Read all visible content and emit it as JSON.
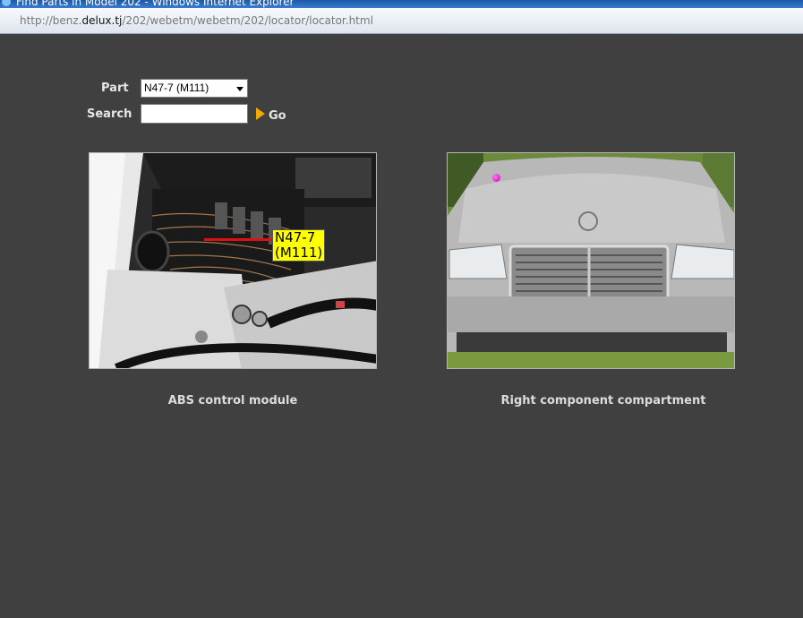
{
  "window": {
    "title": "Find Parts in Model 202 - Windows Internet Explorer"
  },
  "address": {
    "prefix": "http://benz.",
    "domain": "delux.tj",
    "suffix": "/202/webetm/webetm/202/locator/locator.html"
  },
  "form": {
    "part_label": "Part",
    "part_value": "N47-7 (M111)",
    "search_label": "Search",
    "search_value": "",
    "go_label": "Go"
  },
  "photos": {
    "left": {
      "callout_line1": "N47-7",
      "callout_line2": "(M111)",
      "caption": "ABS control module"
    },
    "right": {
      "caption": "Right component compartment"
    }
  },
  "colors": {
    "background": "#404040",
    "callout": "#ffff00",
    "marker": "#d000b8",
    "go_arrow": "#f5a800"
  }
}
